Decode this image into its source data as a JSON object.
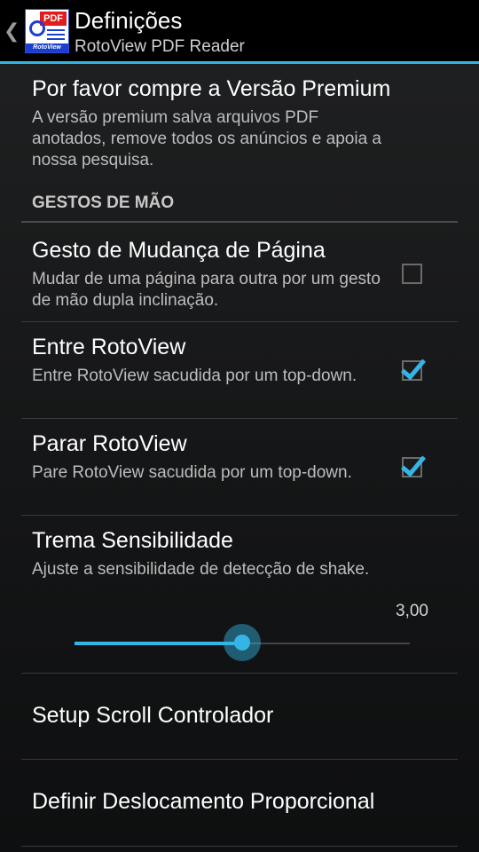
{
  "colors": {
    "accent": "#33b5e5",
    "actionbar": "#000000"
  },
  "actionbar": {
    "up_icon": "chevron-left-icon",
    "title": "Definições",
    "subtitle": "RotoView PDF Reader",
    "icon_badge": "PDF",
    "icon_band": "RotoView"
  },
  "premium": {
    "title": "Por favor compre a Versão Premium",
    "summary": "A versão premium salva arquivos PDF anotados, remove todos os anúncios e apoia a nossa pesquisa."
  },
  "category": {
    "label": "GESTOS DE MÃO"
  },
  "prefs": [
    {
      "title": "Gesto de Mudança de Página",
      "summary": "Mudar de uma página para outra por um gesto de mão dupla inclinação.",
      "checked": false
    },
    {
      "title": "Entre RotoView",
      "summary": "Entre RotoView sacudida por um top-down.",
      "checked": true
    },
    {
      "title": "Parar RotoView",
      "summary": "Pare RotoView sacudida por um top-down.",
      "checked": true
    }
  ],
  "sensitivity": {
    "title": "Trema Sensibilidade",
    "summary": "Ajuste a sensibilidade de detecção de shake.",
    "value_label": "3,00",
    "fraction": 0.5
  },
  "scroll_setup": {
    "title": "Setup Scroll Controlador"
  },
  "proportional": {
    "title": "Definir Deslocamento Proporcional"
  }
}
